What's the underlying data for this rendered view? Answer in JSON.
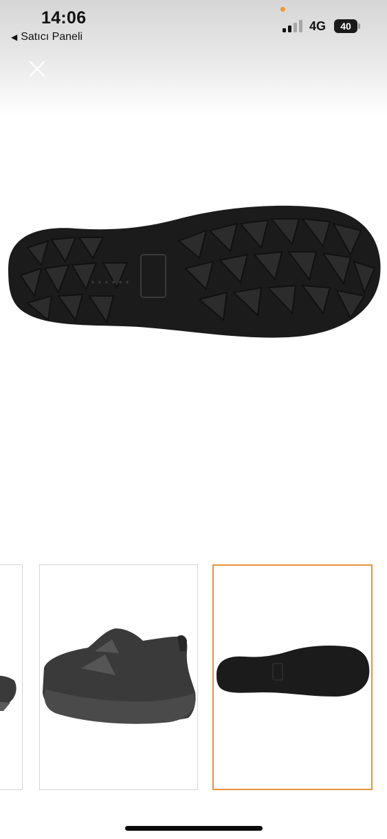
{
  "status_bar": {
    "time": "14:06",
    "back_app_label": "Satıcı Paneli",
    "network": "4G",
    "battery": "40",
    "privacy_indicator_color": "#f29a2e"
  },
  "gallery": {
    "close_icon": "close-icon",
    "selected_index": 2,
    "selected_border_color": "#e8913a",
    "thumbnails": [
      {
        "subject": "shoe-side-partial"
      },
      {
        "subject": "shoe-rear-side"
      },
      {
        "subject": "shoe-outsole"
      }
    ]
  }
}
